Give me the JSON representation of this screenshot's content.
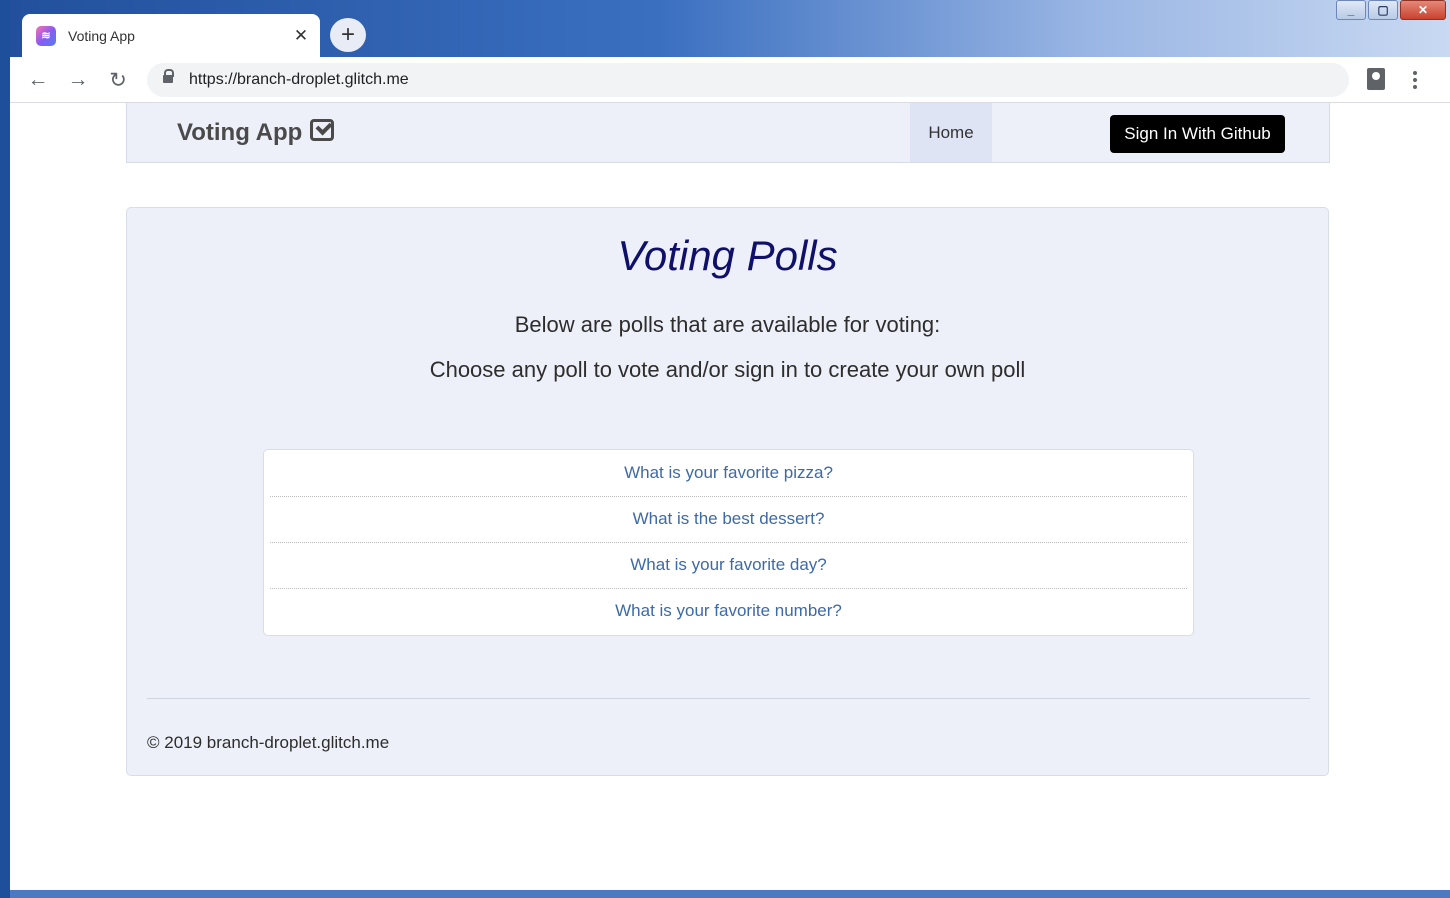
{
  "browser": {
    "tab_title": "Voting App",
    "tab_close": "✕",
    "new_tab": "+",
    "url": "https://branch-droplet.glitch.me",
    "back": "←",
    "forward": "→",
    "reload": "↻",
    "window_controls": {
      "minimize": "_",
      "maximize": "▢",
      "close": "✕"
    }
  },
  "navbar": {
    "brand": "Voting App",
    "home": "Home",
    "signin": "Sign In With Github"
  },
  "main": {
    "title": "Voting Polls",
    "line1": "Below are polls that are available for voting:",
    "line2": "Choose any poll to vote and/or sign in to create your own poll",
    "polls": [
      "What is your favorite pizza?",
      "What is the best dessert?",
      "What is your favorite day?",
      "What is your favorite number?"
    ],
    "footer": "© 2019 branch-droplet.glitch.me"
  },
  "colors": {
    "title": "#10106a",
    "poll_link": "#3d6aa8",
    "signin_bg": "#000000",
    "panel_bg": "#edf0f8"
  }
}
